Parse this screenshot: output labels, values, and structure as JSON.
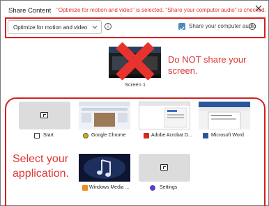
{
  "dialog": {
    "title": "Share Content",
    "annotation": "\"Optimize for motion and video\" is selected. \"Share your computer audio\" is checked."
  },
  "options": {
    "optimize_selected": "Optimize for motion and video",
    "share_audio_label": "Share your computer audio",
    "share_audio_checked": true
  },
  "screens": [
    {
      "label": "Screen 1"
    }
  ],
  "callouts": {
    "screen_line1": "Do NOT share your",
    "screen_line2": "screen.",
    "app_line1": "Select your",
    "app_line2": "application."
  },
  "apps": [
    {
      "label": "Start",
      "icon": "window-icon"
    },
    {
      "label": "Google Chrome",
      "icon": "chrome-icon"
    },
    {
      "label": "Adobe Acrobat D...",
      "icon": "acrobat-icon"
    },
    {
      "label": "Microsoft Word",
      "icon": "word-icon"
    },
    {
      "label": "Windows Media ...",
      "icon": "media-player-icon"
    },
    {
      "label": "Settings",
      "icon": "settings-icon"
    }
  ],
  "colors": {
    "annotation_red": "#e03636",
    "checkbox_blue": "#4a8db8",
    "tile_gray": "#dcdcdc",
    "word_blue": "#2b579a"
  }
}
